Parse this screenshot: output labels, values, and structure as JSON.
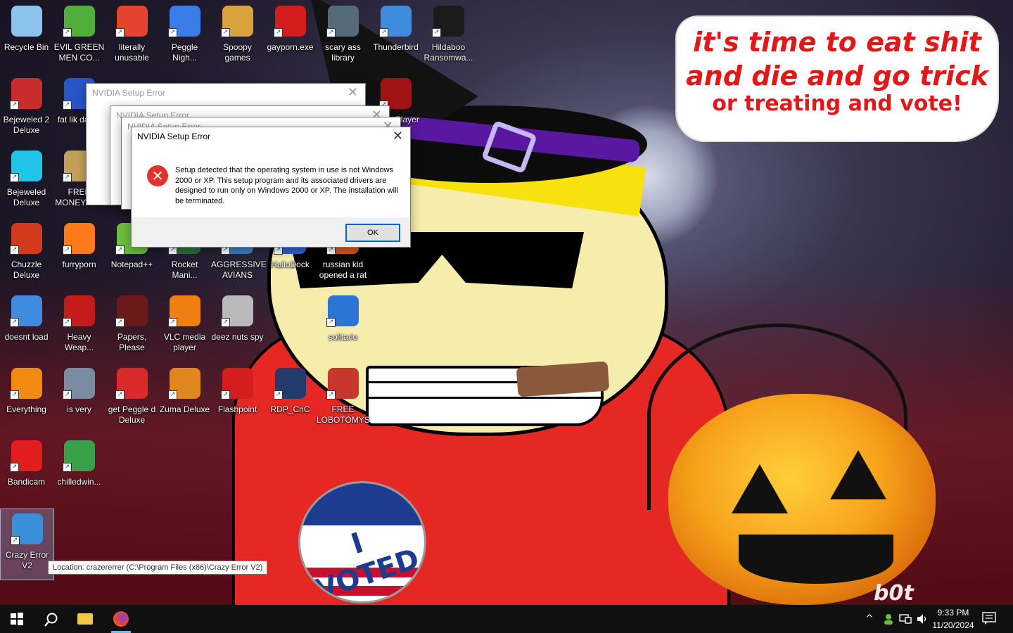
{
  "wallpaper": {
    "bubble": {
      "line1": "it's time to eat shit",
      "line2": "and die and go trick",
      "line3": "or treating and vote!"
    },
    "sticker_text": "I VOTED",
    "signature": "b0t"
  },
  "desktop_icons": [
    {
      "label": "Recycle Bin",
      "icon": "recycle-bin-icon",
      "color": "#8cc4ee"
    },
    {
      "label": "EVIL GREEN MEN CO...",
      "icon": "green-people-icon",
      "color": "#4fae3a"
    },
    {
      "label": "literally unusable",
      "icon": "chrome-icon",
      "color": "#e5432d"
    },
    {
      "label": "Peggle Nigh...",
      "icon": "peggle-icon",
      "color": "#3a7de8"
    },
    {
      "label": "Spoopy games",
      "icon": "folder-icon",
      "color": "#d9a23b"
    },
    {
      "label": "gayporn.exe",
      "icon": "flash-icon",
      "color": "#d41d1d"
    },
    {
      "label": "scary ass library",
      "icon": "library-icon",
      "color": "#556b7a"
    },
    {
      "label": "Thunderbird",
      "icon": "thunderbird-icon",
      "color": "#3f8be0"
    },
    {
      "label": "Hildaboo Ransomwa...",
      "icon": "yashma-icon",
      "color": "#1b1b1b"
    },
    {
      "label": "Bejeweled 2 Deluxe",
      "icon": "bejeweled2-icon",
      "color": "#c82c2c"
    },
    {
      "label": "fat lik darko",
      "icon": "mario-icon",
      "color": "#2a55c8"
    },
    {
      "label": "Flash Player",
      "icon": "flash-player-icon",
      "color": "#a11414"
    },
    {
      "label": "Bejeweled Deluxe",
      "icon": "gem-icon",
      "color": "#1fc4e6"
    },
    {
      "label": "FREE MONEY.co...",
      "icon": "money-bag-icon",
      "color": "#c2a05a"
    },
    {
      "label": "Chuzzle Deluxe",
      "icon": "chuzzle-icon",
      "color": "#d23a1e"
    },
    {
      "label": "furryporn",
      "icon": "firefox-icon",
      "color": "#ff7a1a"
    },
    {
      "label": "Notepad++",
      "icon": "notepad-icon",
      "color": "#6cbd3f"
    },
    {
      "label": "Rocket Mani...",
      "icon": "rocket-icon",
      "color": "#2f6e3f"
    },
    {
      "label": "AGGRESSIVE AVIANS",
      "icon": "birds-icon",
      "color": "#3b7fc8"
    },
    {
      "label": "HalloDock",
      "icon": "dock-icon",
      "color": "#2b64c9"
    },
    {
      "label": "russian kid opened a rat",
      "icon": "rat-icon",
      "color": "#d65a1c"
    },
    {
      "label": "doesnt load",
      "icon": "thunderbird2-icon",
      "color": "#3f8be0"
    },
    {
      "label": "Heavy Weap...",
      "icon": "radiation-icon",
      "color": "#c41b1b"
    },
    {
      "label": "Papers, Please",
      "icon": "papers-icon",
      "color": "#6b1a1a"
    },
    {
      "label": "VLC media player",
      "icon": "vlc-cone-icon",
      "color": "#f07f12"
    },
    {
      "label": "deez nuts spy",
      "icon": "windows-stack-icon",
      "color": "#b9b9b9"
    },
    {
      "label": "solitario",
      "icon": "cards-icon",
      "color": "#2b76d4"
    },
    {
      "label": "Everything",
      "icon": "magnifier-icon",
      "color": "#f28a12"
    },
    {
      "label": "is very",
      "icon": "shield-m-icon",
      "color": "#7c8ca0"
    },
    {
      "label": "get Peggle d Deluxe",
      "icon": "peggle-deluxe-icon",
      "color": "#d92b2b"
    },
    {
      "label": "Zuma Deluxe",
      "icon": "zuma-icon",
      "color": "#e0861e"
    },
    {
      "label": "Flashpoint",
      "icon": "flashpoint-icon",
      "color": "#d41d1d"
    },
    {
      "label": "RDP_CnC",
      "icon": "rdp-icon",
      "color": "#223a6c"
    },
    {
      "label": "FREE LOBOTOMYS",
      "icon": "lobotomy-icon",
      "color": "#c9362b"
    },
    {
      "label": "Bandicam",
      "icon": "record-icon",
      "color": "#e21d1d"
    },
    {
      "label": "chilledwin...",
      "icon": "windows-xp-icon",
      "color": "#3aa04a"
    },
    {
      "label": "Crazy Error V2",
      "icon": "error-window-icon",
      "color": "#3a8fd8"
    }
  ],
  "dialogs": {
    "back_title": "NVIDIA Setup Error",
    "main": {
      "title": "NVIDIA Setup Error",
      "message": "Setup detected that the operating system in use is not Windows 2000 or XP. This setup program and its associated drivers are designed to run only on Windows 2000 or XP. The installation will be terminated.",
      "ok_label": "OK",
      "close_glyph": "✕"
    }
  },
  "tooltip": "Location: crazererrer (C:\\Program Files (x86)\\Crazy Error V2)",
  "taskbar": {
    "time": "9:33 PM",
    "date": "11/20/2024",
    "accent": "#76b9ed"
  }
}
